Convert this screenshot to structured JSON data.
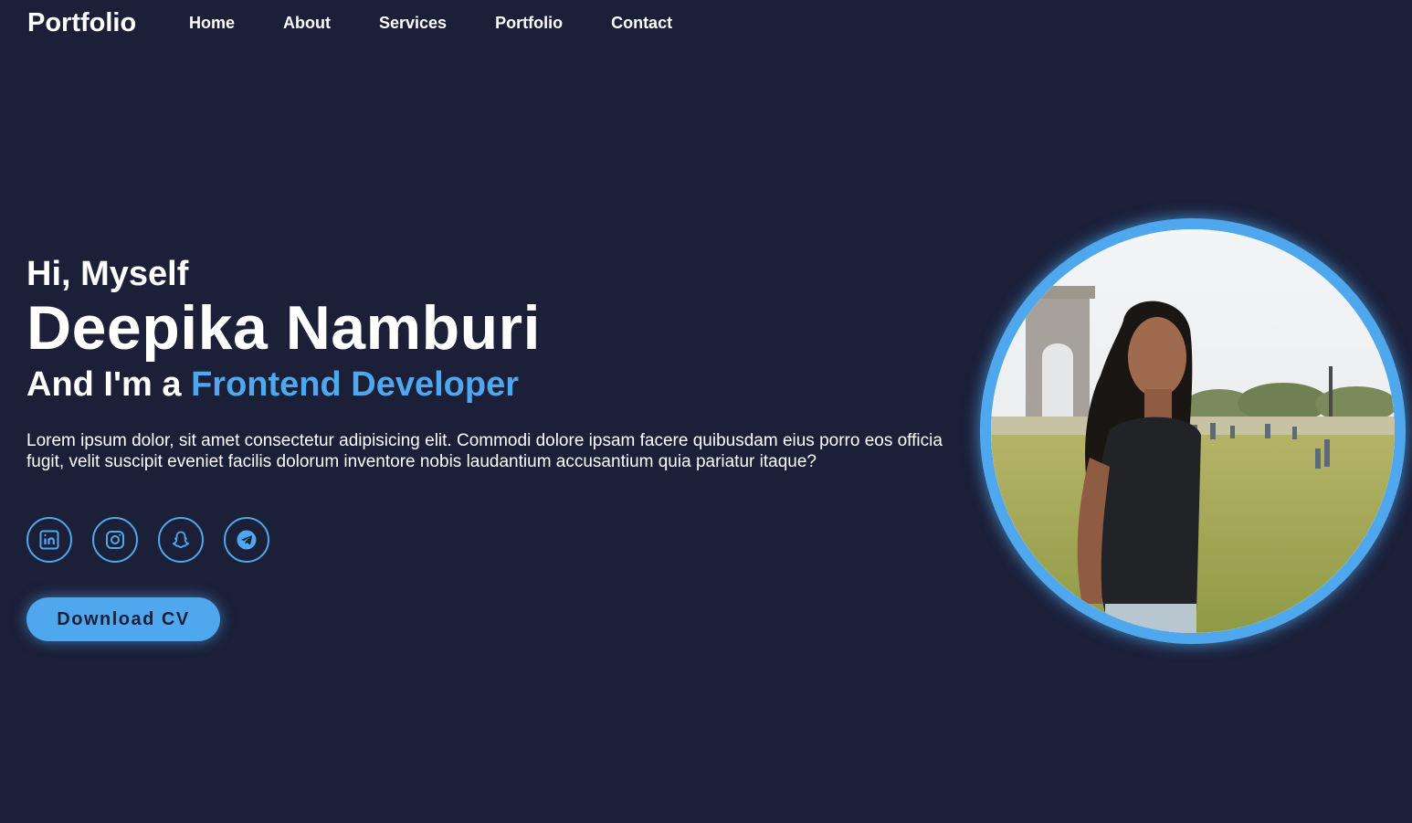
{
  "header": {
    "logo": "Portfolio",
    "nav": [
      "Home",
      "About",
      "Services",
      "Portfolio",
      "Contact"
    ]
  },
  "hero": {
    "greeting": "Hi, Myself",
    "name": "Deepika Namburi",
    "role_prefix": "And I'm a ",
    "role_highlight": "Frontend Developer",
    "description": "Lorem ipsum dolor, sit amet consectetur adipisicing elit. Commodi dolore ipsam facere quibusdam eius porro eos officia fugit, velit suscipit eveniet facilis dolorum inventore nobis laudantium accusantium quia pariatur itaque?",
    "socials": [
      "linkedin-icon",
      "instagram-icon",
      "snapchat-icon",
      "telegram-icon"
    ],
    "cv_button": "Download CV"
  },
  "colors": {
    "background": "#1b1f38",
    "accent": "#4fa8ee",
    "text": "#ffffff"
  }
}
